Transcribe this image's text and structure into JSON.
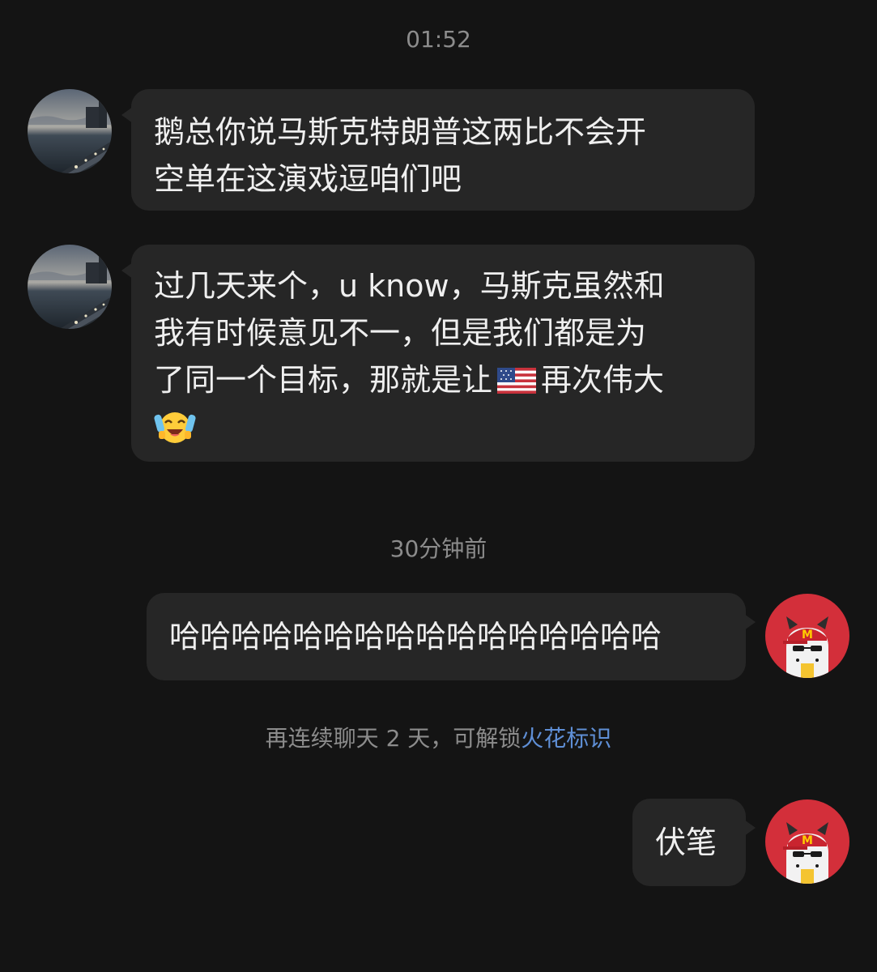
{
  "timestamps": {
    "top": "01:52",
    "middle": "30分钟前"
  },
  "messages": [
    {
      "side": "incoming",
      "lines": [
        "鹅总你说马斯克特朗普这两比不会开",
        "空单在这演戏逗咱们吧"
      ]
    },
    {
      "side": "incoming",
      "line1": "过几天来个，u know，马斯克虽然和",
      "line2": "我有时候意见不一，但是我们都是为",
      "line3_before_flag": "了同一个目标，那就是让",
      "line3_after_flag": "再次伟大",
      "emojis": [
        "us-flag-emoji",
        "laughing-face-emoji"
      ]
    },
    {
      "side": "outgoing",
      "text": "哈哈哈哈哈哈哈哈哈哈哈哈哈哈哈哈"
    },
    {
      "side": "outgoing",
      "text": "伏笔"
    }
  ],
  "streak_notice": {
    "text": "再连续聊天 2 天，可解锁",
    "link": "火花标识"
  },
  "colors": {
    "background": "#141414",
    "bubble": "#262626",
    "link": "#5f8fd6",
    "avatar_red": "#d32f3a"
  },
  "icons": [
    "landscape-avatar",
    "red-mascot-avatar"
  ]
}
